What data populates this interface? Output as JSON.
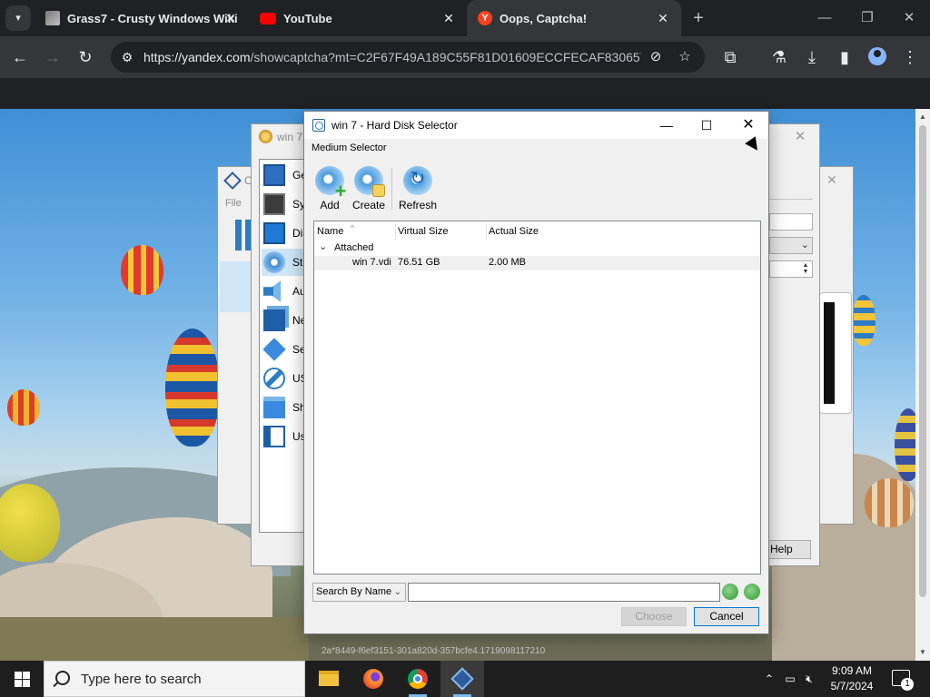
{
  "browser": {
    "tabs": [
      {
        "title": "Grass7 - Crusty Windows Wiki",
        "icon": "grass7-favicon",
        "active": false
      },
      {
        "title": "YouTube",
        "icon": "youtube-favicon",
        "active": false
      },
      {
        "title": "Oops, Captcha!",
        "icon": "yandex-favicon",
        "active": true
      }
    ],
    "url_host": "https://yandex.com",
    "url_path": "/showcaptcha?mt=C2F67F49A189C55F81D01609ECCFECAF830657E..."
  },
  "background_windows": {
    "settings_title": "win 7",
    "manager_title_initial": "O",
    "manager_menu_file": "File",
    "settings_items": [
      {
        "label": "Ge",
        "icon": "general-icon"
      },
      {
        "label": "Sy",
        "icon": "system-icon"
      },
      {
        "label": "Dis",
        "icon": "display-icon"
      },
      {
        "label": "Sto",
        "icon": "storage-icon",
        "selected": true
      },
      {
        "label": "Au",
        "icon": "audio-icon"
      },
      {
        "label": "Ne",
        "icon": "network-icon"
      },
      {
        "label": "Se",
        "icon": "serial-ports-icon"
      },
      {
        "label": "US",
        "icon": "usb-icon"
      },
      {
        "label": "Sh",
        "icon": "shared-folders-icon"
      },
      {
        "label": "Us",
        "icon": "user-interface-icon"
      }
    ],
    "help_button": "Help",
    "footer_text": "2a*8449-f6ef3151-301a820d-357bcfe4.1719098117210"
  },
  "dialog": {
    "title": "win 7 - Hard Disk Selector",
    "section_label": "Medium Selector",
    "toolbar": {
      "add": "Add",
      "create": "Create",
      "refresh": "Refresh"
    },
    "columns": {
      "name": "Name",
      "virtual_size": "Virtual Size",
      "actual_size": "Actual Size"
    },
    "group": "Attached",
    "rows": [
      {
        "name": "win 7.vdi",
        "virtual_size": "76.51 GB",
        "actual_size": "2.00 MB"
      }
    ],
    "search_mode": "Search By Name",
    "search_value": "",
    "choose_button": "Choose",
    "cancel_button": "Cancel"
  },
  "taskbar": {
    "search_placeholder": "Type here to search",
    "apps": [
      {
        "name": "file-explorer-icon"
      },
      {
        "name": "firefox-icon"
      },
      {
        "name": "chrome-icon"
      },
      {
        "name": "virtualbox-icon",
        "active": true
      }
    ],
    "time": "9:09 AM",
    "date": "5/7/2024",
    "notification_count": "1"
  },
  "colors": {
    "chrome_dark": "#202124",
    "chrome_toolbar": "#35363a",
    "taskbar": "#1e1e1e",
    "dialog_bg": "#f0f0f0",
    "accent": "#0078d7"
  }
}
